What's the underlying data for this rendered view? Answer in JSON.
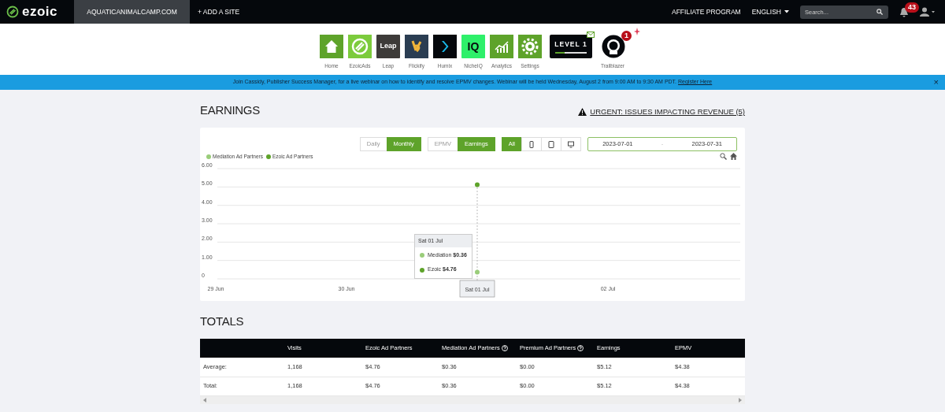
{
  "navbar": {
    "logo": "ezoic",
    "site": "AQUATICANIMALCAMP.COM",
    "add_site": "+ ADD A SITE",
    "links": [
      "AFFILIATE PROGRAM",
      "ENGLISH"
    ],
    "search": {
      "placeholder": "Search..."
    },
    "notifications": "43"
  },
  "apps": [
    {
      "label": "Home",
      "kind": "home"
    },
    {
      "label": "EzoicAds",
      "kind": "ezoicads"
    },
    {
      "label": "Leap",
      "kind": "leap",
      "logo": "Leap"
    },
    {
      "label": "Flickify",
      "kind": "flickify"
    },
    {
      "label": "Humix",
      "kind": "humix"
    },
    {
      "label": "NicheIQ",
      "kind": "nicheiq",
      "logo": "IQ"
    },
    {
      "label": "Analytics",
      "kind": "analytics"
    },
    {
      "label": "Settings",
      "kind": "settings"
    },
    {
      "kind": "level",
      "logo": "LEVEL 1",
      "level": 0.3
    },
    {
      "label": "Trailblazer",
      "kind": "trailblazer",
      "badge": "1"
    }
  ],
  "banner": {
    "text": "Join Cassidy, Publisher Success Manager, for a live webinar on how to identify and resolve EPMV changes. Webinar will be held Wednesday, August 2 from 9:00 AM to 9:30 AM PDT.",
    "link": "Register Here",
    "close": "×"
  },
  "earnings": {
    "title": "EARNINGS",
    "urgent_link": "URGENT: ISSUES IMPACTING REVENUE (5)",
    "period_buttons": [
      {
        "label": "Daily",
        "selected": false
      },
      {
        "label": "Monthly",
        "selected": true
      }
    ],
    "metric_buttons": [
      {
        "label": "EPMV",
        "selected": false
      },
      {
        "label": "Earnings",
        "selected": true
      }
    ],
    "device_buttons": [
      {
        "kind": "text",
        "label": "All",
        "selected": true
      },
      {
        "kind": "phone",
        "selected": false
      },
      {
        "kind": "tablet",
        "selected": false
      },
      {
        "kind": "desktop",
        "selected": false
      }
    ],
    "date_from": "2023-07-01",
    "date_separator": "-",
    "date_to": "2023-07-31",
    "crosshair_label": "Sat 01 Jul",
    "chart_data": {
      "type": "scatter",
      "categories": [
        "29 Jun",
        "30 Jun",
        null,
        "02 Jul"
      ],
      "grid": true,
      "series": [
        {
          "name": "Mediation Ad Partners",
          "color": "#9acd7a",
          "values": [
            null,
            null,
            0.36,
            null
          ]
        },
        {
          "name": "Ezoic Ad Partners",
          "color": "#5ea32a",
          "values": [
            null,
            null,
            5.12,
            null
          ]
        }
      ],
      "ylim": [
        0,
        6
      ],
      "yticks": [
        {
          "value": 0,
          "label": "0"
        },
        {
          "value": 1,
          "label": "1.00"
        },
        {
          "value": 2,
          "label": "2.00"
        },
        {
          "value": 3,
          "label": "3.00"
        },
        {
          "value": 4,
          "label": "4.00"
        },
        {
          "value": 5,
          "label": "5.00"
        },
        {
          "value": 6,
          "label": "6.00"
        }
      ]
    },
    "tooltip": {
      "title": "Sat 01 Jul",
      "items": [
        {
          "label": "Mediation",
          "value": "$0.36",
          "color": "#9acd7a"
        },
        {
          "label": "Ezoic",
          "value": "$4.76",
          "color": "#5ea32a"
        }
      ]
    }
  },
  "totals": {
    "title": "TOTALS",
    "columns": [
      {
        "help": false
      },
      {
        "label": "Visits",
        "help": false
      },
      {
        "label": "Ezoic Ad Partners",
        "help": false
      },
      {
        "label": "Mediation Ad Partners",
        "help": true
      },
      {
        "label": "Premium Ad Partners",
        "help": true
      },
      {
        "label": "Earnings",
        "help": false
      },
      {
        "label": "EPMV",
        "help": false
      }
    ],
    "rows": [
      [
        "Average:",
        "1,168",
        "$4.76",
        "$0.36",
        "$0.00",
        "$5.12",
        "$4.38"
      ],
      [
        "Total:",
        "1,168",
        "$4.76",
        "$0.36",
        "$0.00",
        "$5.12",
        "$4.38"
      ]
    ]
  }
}
